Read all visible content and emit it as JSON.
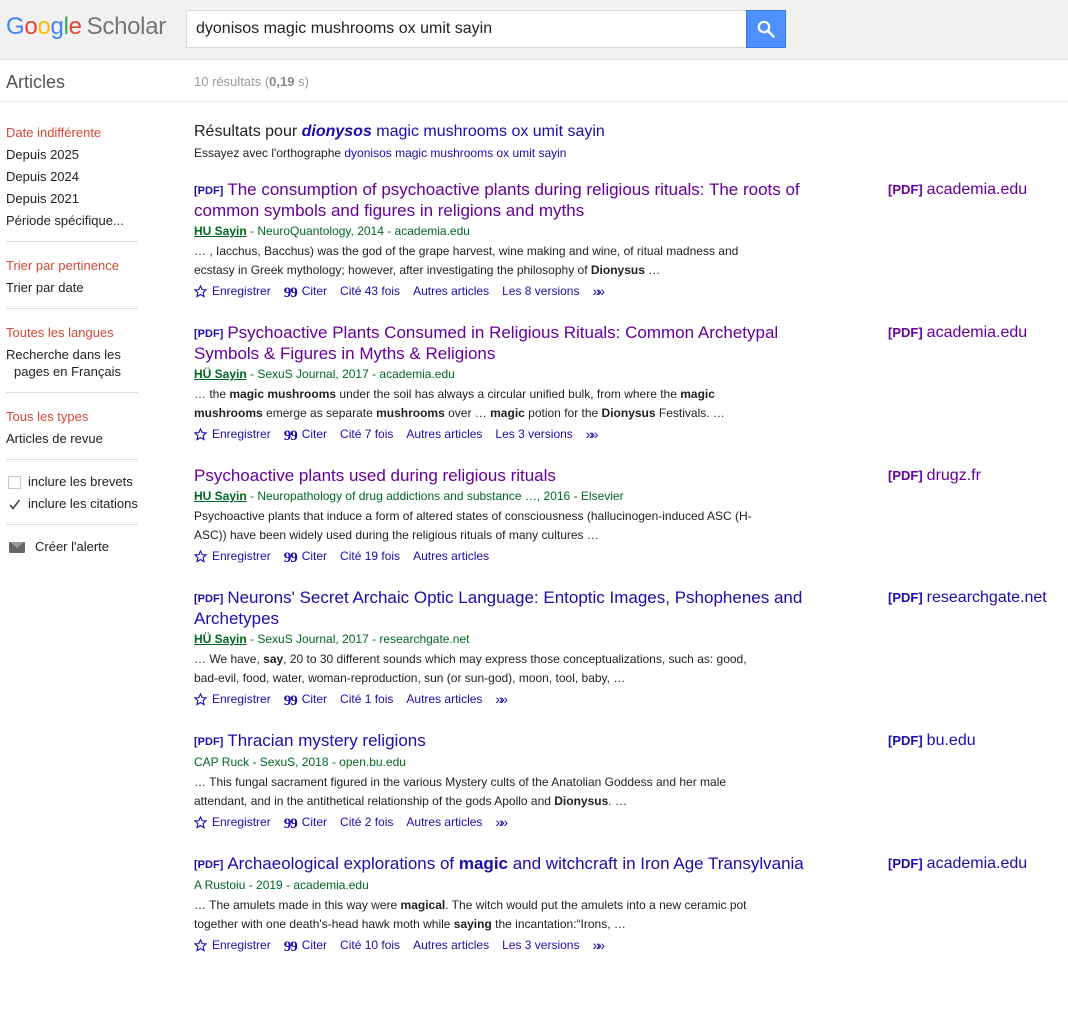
{
  "logo": {
    "google": [
      "G",
      "o",
      "o",
      "g",
      "l",
      "e"
    ],
    "scholar": "Scholar"
  },
  "search": {
    "value": "dyonisos magic mushrooms ox umit sayin"
  },
  "subheader": {
    "articles_label": "Articles",
    "count_pre": "10 résultats (",
    "count_time": "0,19",
    "count_post": " s)"
  },
  "sidebar": {
    "date": {
      "any": "Date indifférente",
      "since2025": "Depuis 2025",
      "since2024": "Depuis 2024",
      "since2021": "Depuis 2021",
      "custom": "Période spécifique..."
    },
    "sort": {
      "relevance": "Trier par pertinence",
      "date": "Trier par date"
    },
    "lang": {
      "all": "Toutes les langues",
      "fr_line1": "Recherche dans les",
      "fr_line2": "pages en Français"
    },
    "type": {
      "all": "Tous les types",
      "review": "Articles de revue"
    },
    "patents": "inclure les brevets",
    "citations": "inclure les citations",
    "alert": "Créer l'alerte"
  },
  "didyoumean": {
    "prefix": "Résultats pour ",
    "corrected": "dionysos",
    "rest": " magic mushrooms ox umit sayin"
  },
  "tryinstead": {
    "prefix": "Essayez avec l'orthographe ",
    "query": "dyonisos magic mushrooms ox umit sayin"
  },
  "labels": {
    "pdf": "[PDF]",
    "save": "Enregistrer",
    "cite": "Citer"
  },
  "results": [
    {
      "title": "The consumption of psychoactive plants during religious rituals: The roots of common symbols and figures in religions and myths",
      "author": "HU Sayin",
      "meta_rest": " - NeuroQuantology, 2014 - academia.edu",
      "snippet_html": "… , Iacchus, Bacchus) was the god of the grape harvest, wine making and wine, of ritual madness and ecstasy in Greek mythology; however, after investigating the philosophy of <b>Dionysus</b> …",
      "cited": "Cité 43 fois",
      "related": "Autres articles",
      "versions": "Les 8 versions",
      "side_domain": "academia.edu"
    },
    {
      "title": "Psychoactive Plants Consumed in Religious Rituals: Common Archetypal Symbols & Figures in Myths & Religions",
      "author": "HÜ Sayin",
      "meta_rest": " - SexuS Journal, 2017 - academia.edu",
      "snippet_html": "… the <b>magic mushrooms</b> under the soil has always a circular unified bulk, from where the <b>magic mushrooms</b> emerge as separate <b>mushrooms</b> over … <b>magic</b> potion for the <b>Dionysus</b> Festivals. …",
      "cited": "Cité 7 fois",
      "related": "Autres articles",
      "versions": "Les 3 versions",
      "side_domain": "academia.edu"
    },
    {
      "title": "Psychoactive plants used during religious rituals",
      "author": "HU Sayin",
      "meta_rest": " - Neuropathology of drug addictions and substance …, 2016 - Elsevier",
      "snippet_html": "Psychoactive plants that induce a form of altered states of consciousness (hallucinogen-induced ASC (H-ASC)) have been widely used during the religious rituals of many cultures …",
      "cited": "Cité 19 fois",
      "related": "Autres articles",
      "side_domain": "drugz.fr"
    },
    {
      "title": "Neurons' Secret Archaic Optic Language: Entoptic Images, Pshophenes and Archetypes",
      "author": "HÜ Sayin",
      "meta_rest": " - SexuS Journal, 2017 - researchgate.net",
      "snippet_html": "… We have, <b>say</b>, 20 to 30 different sounds which may express those conceptualizations, such as: good, bad-evil, food, water, woman-reproduction, sun (or sun-god), moon, tool, baby, …",
      "cited": "Cité 1 fois",
      "related": "Autres articles",
      "side_domain": "researchgate.net"
    },
    {
      "title": "Thracian mystery religions",
      "author": "",
      "meta_rest": "CAP Ruck - SexuS, 2018 - open.bu.edu",
      "snippet_html": "… This fungal sacrament figured in the various Mystery cults of the Anatolian Goddess and her male attendant, and in the antithetical relationship of the gods Apollo and <b>Dionysus</b>. …",
      "cited": "Cité 2 fois",
      "related": "Autres articles",
      "side_domain": "bu.edu"
    },
    {
      "title_html": "Archaeological explorations of <b>magic</b> and witchcraft in Iron Age Transylvania",
      "author": "",
      "meta_rest": "A Rustoiu - 2019 - academia.edu",
      "snippet_html": "… The amulets made in this way were <b>magical</b>. The witch would put the amulets into a new ceramic pot together with one death's-head hawk moth while <b>saying</b> the incantation:“Irons, …",
      "cited": "Cité 10 fois",
      "related": "Autres articles",
      "versions": "Les 3 versions",
      "side_domain": "academia.edu"
    }
  ],
  "colors": {
    "link": "#1a0dab",
    "visited": "#660099",
    "meta_green": "#006621",
    "active_red": "#d14836",
    "search_blue": "#4d90fe"
  }
}
